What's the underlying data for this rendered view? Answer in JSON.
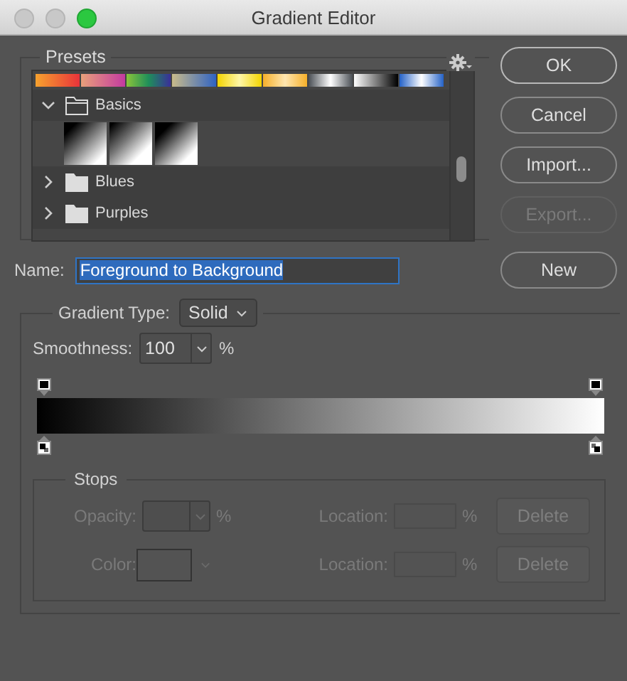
{
  "window": {
    "title": "Gradient Editor"
  },
  "presets": {
    "title": "Presets",
    "groups": [
      {
        "name": "Basics",
        "expanded": true,
        "thumbs": [
          {
            "kind": "fg-bg"
          },
          {
            "kind": "fg-transparent"
          },
          {
            "kind": "black-white"
          }
        ]
      },
      {
        "name": "Blues",
        "expanded": false
      },
      {
        "name": "Purples",
        "expanded": false
      }
    ]
  },
  "buttons": [
    {
      "label": "OK",
      "default": true,
      "disabled": false
    },
    {
      "label": "Cancel",
      "default": false,
      "disabled": false
    },
    {
      "label": "Import...",
      "default": false,
      "disabled": false
    },
    {
      "label": "Export...",
      "default": false,
      "disabled": true
    }
  ],
  "name": {
    "label": "Name:",
    "value": "Foreground to Background",
    "selected": true
  },
  "new_button": {
    "label": "New"
  },
  "gradient": {
    "type_label": "Gradient Type:",
    "type_value": "Solid",
    "smoothness_label": "Smoothness:",
    "smoothness_value": "100",
    "smoothness_unit": "%",
    "opacity_stops": [
      {
        "color": "#000000"
      },
      {
        "color": "#000000"
      }
    ],
    "color_stops": [
      {
        "kind": "foreground",
        "color": "#000000"
      },
      {
        "kind": "background",
        "color": "#ffffff"
      }
    ]
  },
  "stops": {
    "title": "Stops",
    "disabled": true,
    "rows": [
      {
        "kind": "opacity",
        "label": "Opacity:",
        "unit": "%",
        "location_label": "Location:",
        "location_unit": "%",
        "button": "Delete"
      },
      {
        "kind": "color",
        "label": "Color:",
        "location_label": "Location:",
        "location_unit": "%",
        "button": "Delete"
      }
    ]
  }
}
